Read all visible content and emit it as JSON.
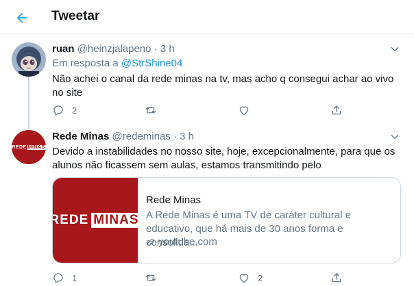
{
  "header": {
    "title": "Tweetar"
  },
  "tweets": [
    {
      "name": "ruan",
      "handle": "@heinzjalapeno",
      "separator": "·",
      "time": "3 h",
      "reply_prefix": "Em resposta a",
      "reply_mention": "@StrShine04",
      "text": "Não achei o canal da rede minas na tv, mas acho q consegui achar ao vivo no site",
      "reply_count": "2",
      "retweet_count": "",
      "like_count": ""
    },
    {
      "name": "Rede Minas",
      "handle": "@redeminas",
      "separator": "·",
      "time": "3 h",
      "text": "Devido a instabilidades no nosso site, hoje, excepcionalmente, para que os alunos não ficassem sem aulas, estamos transmitindo pelo",
      "avatar_logo": {
        "rede": "REDE",
        "minas": "MINAS"
      },
      "reply_count": "1",
      "retweet_count": "",
      "like_count": "2"
    }
  ],
  "card": {
    "logo_rede": "REDE",
    "logo_minas": "MINAS",
    "title": "Rede Minas",
    "description": "A Rede Minas é uma TV de caráter cultural e educativo, que há mais de 30 anos forma e consolida...",
    "domain": "youtube.com"
  },
  "colors": {
    "accent": "#1da1f2",
    "brand_red": "#a8171b",
    "muted": "#657786",
    "text": "#14171a"
  },
  "icons": {
    "back": "arrow-left-icon",
    "caret": "chevron-down-icon",
    "reply": "reply-icon",
    "retweet": "retweet-icon",
    "like": "heart-icon",
    "share": "share-icon",
    "link": "link-icon"
  }
}
